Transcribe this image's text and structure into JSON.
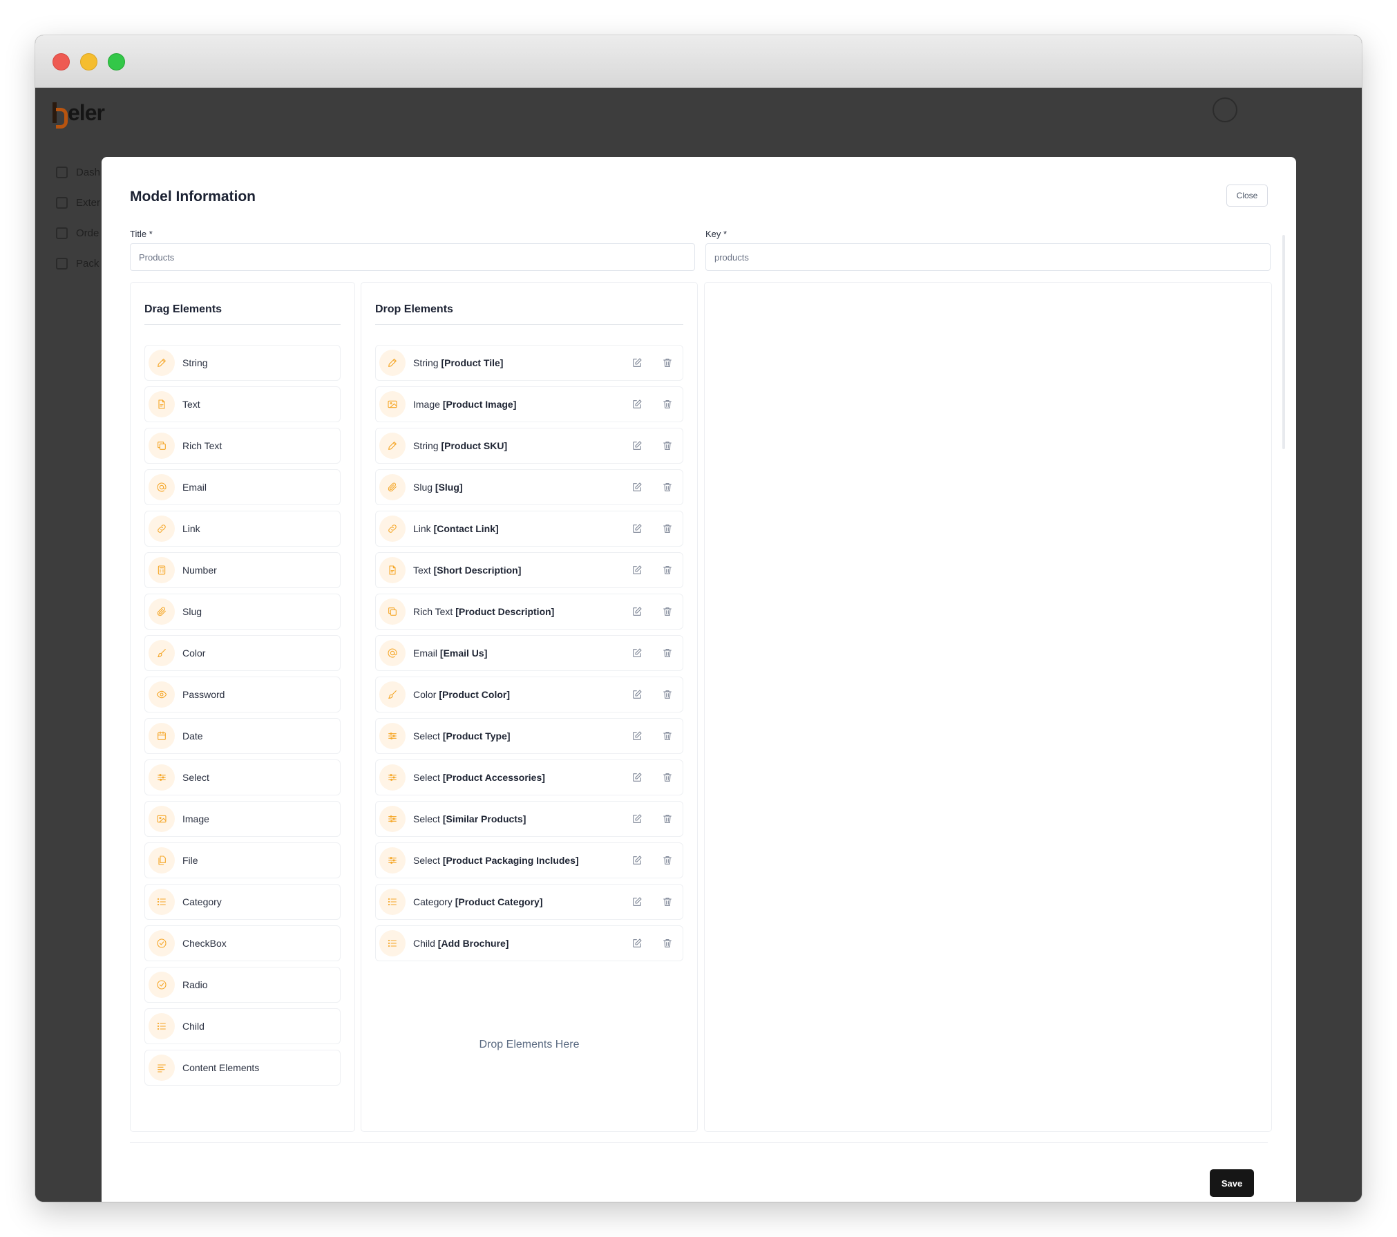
{
  "app": {
    "logo_text": "eler",
    "nav": [
      {
        "label": "Dash"
      },
      {
        "label": "Exter"
      },
      {
        "label": "Orde"
      },
      {
        "label": "Pack"
      }
    ]
  },
  "modal": {
    "title": "Model Information",
    "close_label": "Close",
    "title_field": {
      "label": "Title *",
      "value": "Products"
    },
    "key_field": {
      "label": "Key *",
      "value": "products"
    },
    "drag_panel_title": "Drag Elements",
    "drop_panel_title": "Drop Elements",
    "drop_hint": "Drop Elements Here",
    "save_label": "Save"
  },
  "colors": {
    "accent": "#f5a524",
    "icon_bg": "#fff4e6",
    "action_icon": "#7b8394"
  },
  "drag_elements": [
    {
      "label": "String",
      "icon": "pencil-icon"
    },
    {
      "label": "Text",
      "icon": "document-icon"
    },
    {
      "label": "Rich Text",
      "icon": "copy-icon"
    },
    {
      "label": "Email",
      "icon": "at-icon"
    },
    {
      "label": "Link",
      "icon": "link-icon"
    },
    {
      "label": "Number",
      "icon": "calculator-icon"
    },
    {
      "label": "Slug",
      "icon": "paperclip-icon"
    },
    {
      "label": "Color",
      "icon": "brush-icon"
    },
    {
      "label": "Password",
      "icon": "eye-icon"
    },
    {
      "label": "Date",
      "icon": "calendar-icon"
    },
    {
      "label": "Select",
      "icon": "sliders-icon"
    },
    {
      "label": "Image",
      "icon": "image-icon"
    },
    {
      "label": "File",
      "icon": "files-icon"
    },
    {
      "label": "Category",
      "icon": "list-icon"
    },
    {
      "label": "CheckBox",
      "icon": "check-circle-icon"
    },
    {
      "label": "Radio",
      "icon": "check-circle-icon"
    },
    {
      "label": "Child",
      "icon": "list-icon"
    },
    {
      "label": "Content Elements",
      "icon": "align-left-icon"
    }
  ],
  "drop_elements": [
    {
      "type": "String",
      "name": "[Product Tile]",
      "icon": "pencil-icon"
    },
    {
      "type": "Image",
      "name": "[Product Image]",
      "icon": "image-icon"
    },
    {
      "type": "String",
      "name": "[Product SKU]",
      "icon": "pencil-icon"
    },
    {
      "type": "Slug",
      "name": "[Slug]",
      "icon": "paperclip-icon"
    },
    {
      "type": "Link",
      "name": "[Contact Link]",
      "icon": "link-icon"
    },
    {
      "type": "Text",
      "name": "[Short Description]",
      "icon": "document-icon"
    },
    {
      "type": "Rich Text",
      "name": "[Product Description]",
      "icon": "copy-icon"
    },
    {
      "type": "Email",
      "name": "[Email Us]",
      "icon": "at-icon"
    },
    {
      "type": "Color",
      "name": "[Product Color]",
      "icon": "brush-icon"
    },
    {
      "type": "Select",
      "name": "[Product Type]",
      "icon": "sliders-icon"
    },
    {
      "type": "Select",
      "name": "[Product Accessories]",
      "icon": "sliders-icon"
    },
    {
      "type": "Select",
      "name": "[Similar Products]",
      "icon": "sliders-icon"
    },
    {
      "type": "Select",
      "name": "[Product Packaging Includes]",
      "icon": "sliders-icon"
    },
    {
      "type": "Category",
      "name": "[Product Category]",
      "icon": "list-icon"
    },
    {
      "type": "Child",
      "name": "[Add Brochure]",
      "icon": "list-icon"
    }
  ]
}
